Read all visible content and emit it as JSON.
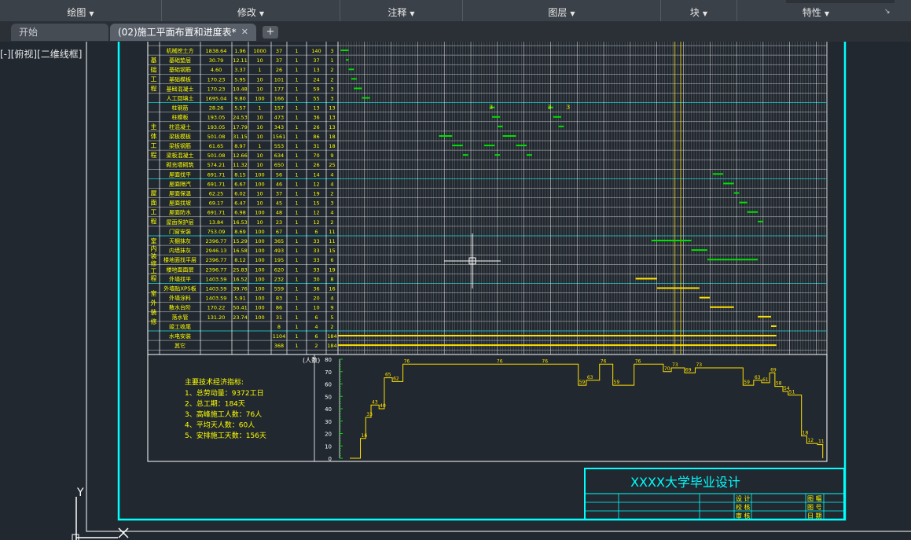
{
  "ribbon": {
    "panels": [
      {
        "label": "绘图"
      },
      {
        "label": "修改"
      },
      {
        "label": "注释"
      },
      {
        "label": "图层"
      },
      {
        "label": "块"
      },
      {
        "label": "特性"
      }
    ]
  },
  "tabs": {
    "start_label": "开始",
    "active_label": "(02)施工平面布置和进度表*",
    "close_symbol": "✕",
    "add_symbol": "+"
  },
  "viewport": {
    "label": "[-][俯视][二维线框]"
  },
  "ucs": {
    "y_label": "Y"
  },
  "table": {
    "groups": [
      {
        "label": "基础工程",
        "rows": [
          0,
          5
        ]
      },
      {
        "label": "主体工程",
        "rows": [
          6,
          13
        ]
      },
      {
        "label": "屋面工程",
        "rows": [
          14,
          19
        ]
      },
      {
        "label": "室内装修工程",
        "rows": [
          20,
          24
        ]
      },
      {
        "label": "室外装修",
        "rows": [
          25,
          29
        ]
      }
    ],
    "rows": [
      {
        "name": "机械挖土方",
        "qty": "1838.64",
        "rate": "1.96",
        "crew": "1000",
        "days": "37",
        "shift": "1",
        "people": "140",
        "dur": "3"
      },
      {
        "name": "基础垫层",
        "qty": "30.79",
        "rate": "12.11",
        "crew": "10",
        "days": "37",
        "shift": "1",
        "people": "37",
        "dur": "1"
      },
      {
        "name": "基础钢筋",
        "qty": "4.60",
        "rate": "3.37",
        "crew": "1",
        "days": "26",
        "shift": "1",
        "people": "13",
        "dur": "2"
      },
      {
        "name": "基础模板",
        "qty": "170.23",
        "rate": "5.95",
        "crew": "10",
        "days": "101",
        "shift": "1",
        "people": "24",
        "dur": "2"
      },
      {
        "name": "基础混凝土",
        "qty": "170.23",
        "rate": "10.48",
        "crew": "10",
        "days": "177",
        "shift": "1",
        "people": "59",
        "dur": "3"
      },
      {
        "name": "人工回填土",
        "qty": "1695.04",
        "rate": "9.80",
        "crew": "100",
        "days": "166",
        "shift": "1",
        "people": "55",
        "dur": "3"
      },
      {
        "name": "柱钢筋",
        "qty": "28.26",
        "rate": "5.57",
        "crew": "1",
        "days": "157",
        "shift": "1",
        "people": "13",
        "dur": "13"
      },
      {
        "name": "柱模板",
        "qty": "193.05",
        "rate": "24.53",
        "crew": "10",
        "days": "473",
        "shift": "1",
        "people": "36",
        "dur": "13"
      },
      {
        "name": "柱混凝土",
        "qty": "193.05",
        "rate": "17.79",
        "crew": "10",
        "days": "343",
        "shift": "1",
        "people": "26",
        "dur": "13"
      },
      {
        "name": "梁板模板",
        "qty": "501.08",
        "rate": "31.15",
        "crew": "10",
        "days": "1561",
        "shift": "1",
        "people": "86",
        "dur": "18"
      },
      {
        "name": "梁板钢筋",
        "qty": "61.65",
        "rate": "8.97",
        "crew": "1",
        "days": "553",
        "shift": "1",
        "people": "31",
        "dur": "18"
      },
      {
        "name": "梁板混凝土",
        "qty": "501.08",
        "rate": "12.66",
        "crew": "10",
        "days": "634",
        "shift": "1",
        "people": "70",
        "dur": "9"
      },
      {
        "name": "砌充墙砌筑",
        "qty": "574.21",
        "rate": "11.32",
        "crew": "10",
        "days": "650",
        "shift": "1",
        "people": "26",
        "dur": "25"
      },
      {
        "name": "屋面找平",
        "qty": "691.71",
        "rate": "8.15",
        "crew": "100",
        "days": "56",
        "shift": "1",
        "people": "14",
        "dur": "4"
      },
      {
        "name": "屋面隔汽",
        "qty": "691.71",
        "rate": "6.67",
        "crew": "100",
        "days": "46",
        "shift": "1",
        "people": "12",
        "dur": "4"
      },
      {
        "name": "屋面保温",
        "qty": "62.25",
        "rate": "6.02",
        "crew": "10",
        "days": "37",
        "shift": "1",
        "people": "19",
        "dur": "2"
      },
      {
        "name": "屋面找坡",
        "qty": "69.17",
        "rate": "6.47",
        "crew": "10",
        "days": "45",
        "shift": "1",
        "people": "15",
        "dur": "3"
      },
      {
        "name": "屋面防水",
        "qty": "691.71",
        "rate": "6.98",
        "crew": "100",
        "days": "48",
        "shift": "1",
        "people": "12",
        "dur": "4"
      },
      {
        "name": "屋面保护层",
        "qty": "13.84",
        "rate": "16.53",
        "crew": "10",
        "days": "23",
        "shift": "1",
        "people": "12",
        "dur": "2"
      },
      {
        "name": "门窗安装",
        "qty": "753.09",
        "rate": "8.69",
        "crew": "100",
        "days": "67",
        "shift": "1",
        "people": "6",
        "dur": "11"
      },
      {
        "name": "天棚抹灰",
        "qty": "2396.77",
        "rate": "15.29",
        "crew": "100",
        "days": "365",
        "shift": "1",
        "people": "33",
        "dur": "11"
      },
      {
        "name": "内墙抹灰",
        "qty": "2946.13",
        "rate": "16.58",
        "crew": "100",
        "days": "493",
        "shift": "1",
        "people": "33",
        "dur": "15"
      },
      {
        "name": "楼地面找平层",
        "qty": "2396.77",
        "rate": "8.12",
        "crew": "100",
        "days": "195",
        "shift": "1",
        "people": "33",
        "dur": "6"
      },
      {
        "name": "楼地面面层",
        "qty": "2396.77",
        "rate": "25.83",
        "crew": "100",
        "days": "620",
        "shift": "1",
        "people": "33",
        "dur": "19"
      },
      {
        "name": "外墙找平",
        "qty": "1403.59",
        "rate": "16.52",
        "crew": "100",
        "days": "232",
        "shift": "1",
        "people": "30",
        "dur": "8"
      },
      {
        "name": "外墙贴XPS板",
        "qty": "1403.59",
        "rate": "39.76",
        "crew": "100",
        "days": "559",
        "shift": "1",
        "people": "36",
        "dur": "16"
      },
      {
        "name": "外墙涂料",
        "qty": "1403.59",
        "rate": "5.91",
        "crew": "100",
        "days": "83",
        "shift": "1",
        "people": "20",
        "dur": "4"
      },
      {
        "name": "散水台阶",
        "qty": "170.22",
        "rate": "50.41",
        "crew": "100",
        "days": "86",
        "shift": "1",
        "people": "10",
        "dur": "9"
      },
      {
        "name": "落水管",
        "qty": "131.20",
        "rate": "23.74",
        "crew": "100",
        "days": "31",
        "shift": "1",
        "people": "6",
        "dur": "5"
      },
      {
        "name": "竣工收尾",
        "qty": "",
        "rate": "",
        "crew": "",
        "days": "8",
        "shift": "1",
        "people": "4",
        "dur": "2"
      },
      {
        "name": "水电安装",
        "qty": "",
        "rate": "",
        "crew": "",
        "days": "1104",
        "shift": "1",
        "people": "6",
        "dur": "184"
      },
      {
        "name": "其它",
        "qty": "",
        "rate": "",
        "crew": "",
        "days": "368",
        "shift": "1",
        "people": "2",
        "dur": "184"
      }
    ]
  },
  "gantt_bars": [
    {
      "row": 0,
      "start": 1,
      "len": 3,
      "color": "#00e000"
    },
    {
      "row": 1,
      "start": 3,
      "len": 1,
      "color": "#00e000"
    },
    {
      "row": 2,
      "start": 4,
      "len": 2,
      "color": "#00e000"
    },
    {
      "row": 3,
      "start": 5,
      "len": 2,
      "color": "#00e000"
    },
    {
      "row": 4,
      "start": 6,
      "len": 3,
      "color": "#00e000"
    },
    {
      "row": 5,
      "start": 9,
      "len": 3,
      "color": "#00e000"
    },
    {
      "row": 6,
      "start": 57,
      "len": 2,
      "color": "#00e000"
    },
    {
      "row": 6,
      "start": 79,
      "len": 2,
      "color": "#00e000"
    },
    {
      "row": 7,
      "start": 58,
      "len": 3,
      "color": "#00e000"
    },
    {
      "row": 7,
      "start": 81,
      "len": 3,
      "color": "#00e000"
    },
    {
      "row": 8,
      "start": 60,
      "len": 2,
      "color": "#00e000"
    },
    {
      "row": 8,
      "start": 83,
      "len": 2,
      "color": "#00e000"
    },
    {
      "row": 9,
      "start": 38,
      "len": 5,
      "color": "#00e000"
    },
    {
      "row": 9,
      "start": 62,
      "len": 5,
      "color": "#00e000"
    },
    {
      "row": 10,
      "start": 43,
      "len": 4,
      "color": "#00e000"
    },
    {
      "row": 10,
      "start": 55,
      "len": 4,
      "color": "#00e000"
    },
    {
      "row": 10,
      "start": 67,
      "len": 4,
      "color": "#00e000"
    },
    {
      "row": 11,
      "start": 47,
      "len": 2,
      "color": "#00e000"
    },
    {
      "row": 11,
      "start": 59,
      "len": 2,
      "color": "#00e000"
    },
    {
      "row": 11,
      "start": 71,
      "len": 2,
      "color": "#00e000"
    },
    {
      "row": 13,
      "start": 141,
      "len": 4,
      "color": "#00e000"
    },
    {
      "row": 14,
      "start": 145,
      "len": 4,
      "color": "#00e000"
    },
    {
      "row": 15,
      "start": 149,
      "len": 2,
      "color": "#00e000"
    },
    {
      "row": 16,
      "start": 151,
      "len": 3,
      "color": "#00e000"
    },
    {
      "row": 17,
      "start": 154,
      "len": 4,
      "color": "#00e000"
    },
    {
      "row": 18,
      "start": 158,
      "len": 2,
      "color": "#00e000"
    },
    {
      "row": 20,
      "start": 118,
      "len": 15,
      "color": "#00e000"
    },
    {
      "row": 21,
      "start": 133,
      "len": 6,
      "color": "#00e000"
    },
    {
      "row": 22,
      "start": 139,
      "len": 19,
      "color": "#00e000"
    },
    {
      "row": 24,
      "start": 112,
      "len": 8,
      "color": "#ffe000"
    },
    {
      "row": 25,
      "start": 120,
      "len": 16,
      "color": "#ffe000"
    },
    {
      "row": 26,
      "start": 136,
      "len": 4,
      "color": "#ffe000"
    },
    {
      "row": 27,
      "start": 140,
      "len": 9,
      "color": "#ffe000"
    },
    {
      "row": 28,
      "start": 158,
      "len": 5,
      "color": "#ffe000"
    },
    {
      "row": 29,
      "start": 163,
      "len": 2,
      "color": "#ffe000"
    },
    {
      "row": 30,
      "start": 0,
      "len": 165,
      "color": "#ffe000"
    },
    {
      "row": 31,
      "start": 0,
      "len": 165,
      "color": "#ffe000"
    }
  ],
  "bar_labels": [
    {
      "row": 6,
      "day": 57,
      "text": "3"
    },
    {
      "row": 6,
      "day": 79,
      "text": "3"
    },
    {
      "row": 6,
      "day": 86,
      "text": "3"
    }
  ],
  "summary": {
    "title": "主要技术经济指标:",
    "items": [
      "1、总劳动量：9372工日",
      "2、总工期：184天",
      "3、高峰施工人数：76人",
      "4、平均天人数：60人",
      "5、安排施工天数：156天"
    ]
  },
  "labor_chart": {
    "axis_label": "(人数)",
    "ticks": [
      "80",
      "70",
      "60",
      "50",
      "40",
      "30",
      "20",
      "10",
      "0"
    ],
    "steps": [
      {
        "day": 0,
        "value": 0,
        "label": ""
      },
      {
        "day": 4,
        "value": 16,
        "label": "16"
      },
      {
        "day": 6,
        "value": 33,
        "label": "33"
      },
      {
        "day": 8,
        "value": 43,
        "label": "43"
      },
      {
        "day": 11,
        "value": 40,
        "label": "40"
      },
      {
        "day": 13,
        "value": 65,
        "label": "65"
      },
      {
        "day": 16,
        "value": 62,
        "label": "62"
      },
      {
        "day": 20,
        "value": 76,
        "label": "76"
      },
      {
        "day": 55,
        "value": 76,
        "label": "76"
      },
      {
        "day": 72,
        "value": 76,
        "label": "76"
      },
      {
        "day": 86,
        "value": 59,
        "label": "59"
      },
      {
        "day": 89,
        "value": 63,
        "label": "63"
      },
      {
        "day": 94,
        "value": 76,
        "label": "76"
      },
      {
        "day": 99,
        "value": 59,
        "label": "59"
      },
      {
        "day": 107,
        "value": 76,
        "label": "76"
      },
      {
        "day": 118,
        "value": 70,
        "label": "70"
      },
      {
        "day": 121,
        "value": 73,
        "label": "73"
      },
      {
        "day": 126,
        "value": 69,
        "label": "69"
      },
      {
        "day": 130,
        "value": 73,
        "label": "73"
      },
      {
        "day": 148,
        "value": 59,
        "label": "59"
      },
      {
        "day": 152,
        "value": 63,
        "label": "63"
      },
      {
        "day": 155,
        "value": 61,
        "label": "61"
      },
      {
        "day": 158,
        "value": 69,
        "label": "69"
      },
      {
        "day": 160,
        "value": 58,
        "label": "58"
      },
      {
        "day": 163,
        "value": 54,
        "label": "54"
      },
      {
        "day": 165,
        "value": 51,
        "label": "51"
      },
      {
        "day": 170,
        "value": 18,
        "label": "18"
      },
      {
        "day": 172,
        "value": 12,
        "label": "12"
      },
      {
        "day": 176,
        "value": 11,
        "label": "11"
      },
      {
        "day": 178,
        "value": 0,
        "label": ""
      }
    ]
  },
  "title_block": {
    "school": "XXXX大学毕业设计",
    "fields_left": [
      "设 计",
      "校 核",
      "审 核"
    ],
    "fields_right": [
      "图 幅",
      "图 号",
      "日 期"
    ]
  },
  "colors": {
    "background": "#212830",
    "table_line": "#ffffff",
    "table_text": "#ffff00",
    "frame": "#00ffff",
    "separator": "#00c8c8",
    "grid": "#b4b4b4",
    "bar_green": "#00e000",
    "bar_yellow": "#ffe000",
    "crosshair": "#ffffff"
  }
}
